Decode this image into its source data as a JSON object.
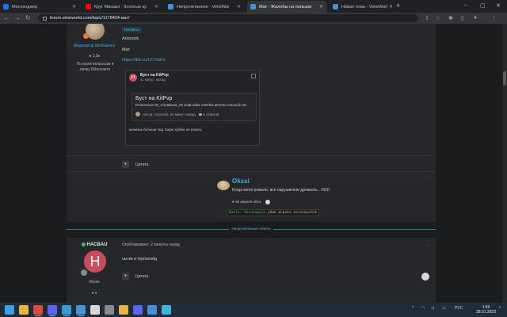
{
  "browser": {
    "tabs": [
      {
        "label": "Мессенджер",
        "icon_color": "#1877f2",
        "active": false
      },
      {
        "label": "Круг Михаил - Золотые ку",
        "icon_color": "#ff0000",
        "active": false
      },
      {
        "label": "Непрочитанное - VimeWorld",
        "icon_color": "#4a90d9",
        "active": false
      },
      {
        "label": "Мат - Жалобы на пользоват",
        "icon_color": "#4a90d9",
        "active": true
      },
      {
        "label": "Новая тема - VimeWorld - Фор",
        "icon_color": "#4a90d9",
        "active": false
      }
    ],
    "new_tab": "+",
    "url": "forum.vimeworld.com/topic/1178424-мат/"
  },
  "post1": {
    "author_role": "Модератор MiniGames",
    "reputation": "1,3к",
    "about": "По всем вопросам в личку ВКонтакте",
    "tag": "HACBAU",
    "lines": [
      "Antonick",
      "Мат",
      "https://ibb.co/LFJ7bRs"
    ],
    "embed": {
      "author_initial": "H",
      "title": "Буст на KitPvp",
      "time": "11 минут назад",
      "inner_title": "Буст на KitPvp",
      "inner_desc": "Deleterious 00_CriptBasta_00 SqdLodka VuRdULaKOOo Antonick 28...",
      "inner_meta_author": "Автор: Antonick, 20 минут назад",
      "inner_meta_replies": "6 ответов",
      "footer": "можешь больше под такую хуйню не рекать"
    },
    "quote_label": "Цитата"
  },
  "signature": {
    "name": "Okssi",
    "text": "Когда меня рожали, все нарушители дрожали... ©DD",
    "date": "18 апреля 2014",
    "code_user": "Duelz: torovayuji",
    "code_rest": " убил игрока torovaychik",
    "more": "…"
  },
  "unread_label": "Непрочитанные ответы",
  "post2": {
    "author": "HACBAU",
    "initial": "H",
    "role": "Игрок",
    "count": "3",
    "meta": "Опубликовано: 2 минуты назад",
    "text": "нытик и терпилойд",
    "quote_label": "Цитата",
    "more": "…"
  },
  "taskbar": {
    "apps": [
      {
        "name": "start",
        "color": "#3aa0e8"
      },
      {
        "name": "explorer",
        "color": "#e8b53a"
      },
      {
        "name": "chrome",
        "color": "#e04a3a"
      },
      {
        "name": "discord",
        "color": "#5865f2"
      },
      {
        "name": "vimeworld",
        "color": "#3a9ad9"
      },
      {
        "name": "launcher",
        "color": "#4a90d9"
      },
      {
        "name": "app7",
        "color": "#d8d8d8"
      },
      {
        "name": "app8",
        "color": "#8a8a8a"
      },
      {
        "name": "app9",
        "color": "#e8b53a"
      },
      {
        "name": "app10",
        "color": "#5865f2"
      },
      {
        "name": "app11",
        "color": "#4a90d9"
      },
      {
        "name": "app12",
        "color": "#3ab8d8"
      }
    ],
    "lang": "РУС",
    "time": "1:59",
    "date": "28.01.2023"
  },
  "colors": {
    "accent": "#4aa5d8",
    "signature_name": "#38b6d6",
    "online": "#34c26b"
  }
}
